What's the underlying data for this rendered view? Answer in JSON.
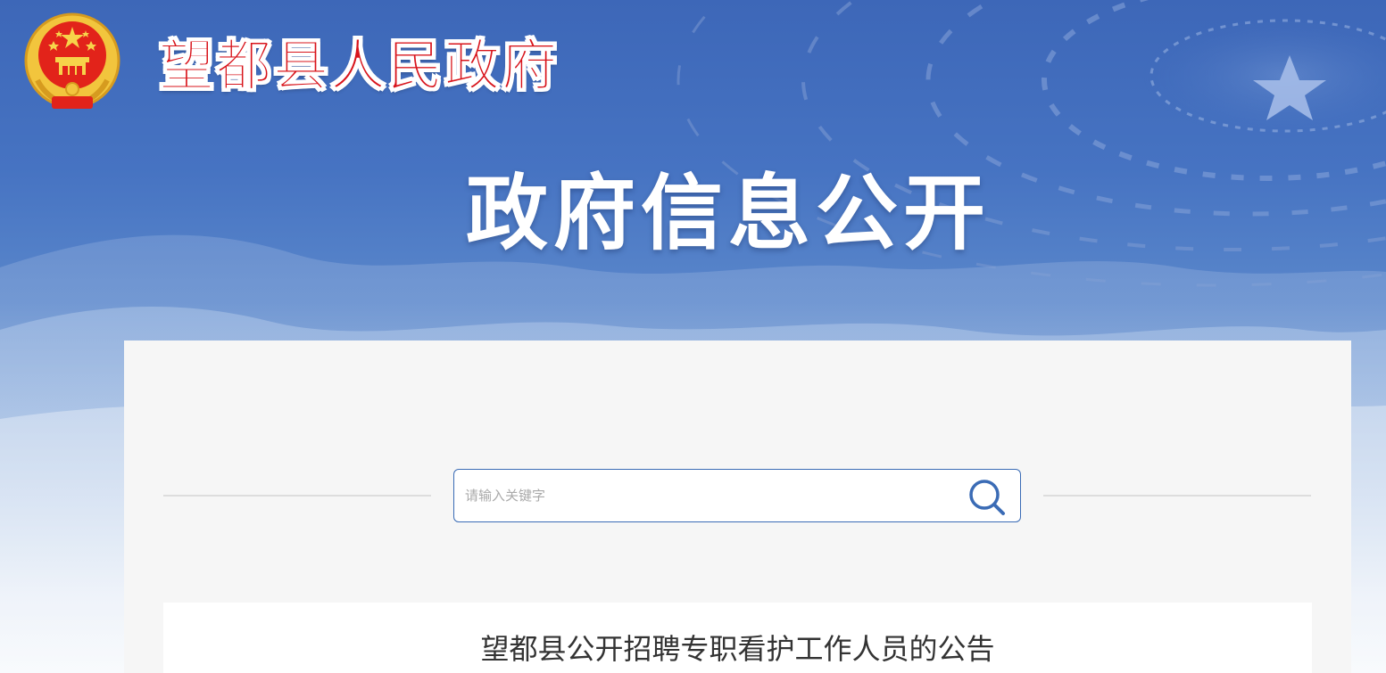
{
  "header": {
    "site_title": "望都县人民政府",
    "banner_title": "政府信息公开"
  },
  "search": {
    "placeholder": "请输入关键字",
    "value": ""
  },
  "article": {
    "title": "望都县公开招聘专职看护工作人员的公告"
  },
  "icons": {
    "logo": "national-emblem-icon",
    "search": "search-icon",
    "banner_star": "star-icon"
  },
  "colors": {
    "header_blue": "#3d67b8",
    "title_red": "#d8141b",
    "accent_blue": "#3a6bb5",
    "panel_bg": "#f6f6f6"
  }
}
